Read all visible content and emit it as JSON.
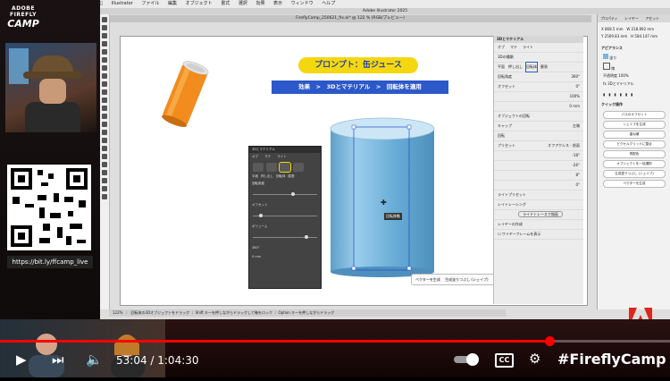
{
  "stream": {
    "logo_line1": "ADOBE FIREFLY",
    "logo_line2": "CAMP",
    "qr_link": "https://bit.ly/ffcamp_live",
    "hashtag": "#FireflyCamp"
  },
  "illustrator": {
    "menu": [
      "Illustrator",
      "ファイル",
      "編集",
      "オブジェクト",
      "書式",
      "選択",
      "効果",
      "表示",
      "ウィンドウ",
      "ヘルプ"
    ],
    "window_title": "Adobe Illustrator 2025",
    "doc_tab": "FireflyCamp_250621_fix.ai* @ 122 % (RGB/プレビュー)",
    "status_text": "回転体の3Dオブジェクトをドラッグ ｜ Shift キーを押しながらドラッグして軸をロック ｜ Option キーを押しながらドラッグ",
    "zoom": "122%"
  },
  "artboard": {
    "prompt_label": "プロンプト：缶ジュース",
    "path_label": "効果　>　3Dとマテリアル　>　回転体を適用",
    "cursor_tooltip": "回転移動"
  },
  "inner_panel": {
    "title": "3Dとマテリアル",
    "tabs": [
      "オブ",
      "マテ",
      "ライト"
    ],
    "type_buttons": [
      "平面",
      "押し出し",
      "回転体",
      "膨張"
    ],
    "rows": [
      "回転角度",
      "オフセット",
      "ボリューム",
      "360°",
      "0 mm"
    ]
  },
  "context_bar": {
    "generate_vector": "ベクターを生成",
    "generate_pattern": "生成塗りつぶし (シェイプ)"
  },
  "panel3d": {
    "title": "3Dとマテリアル",
    "tabs": [
      "オブ",
      "マテ",
      "ライト"
    ],
    "sections": [
      "3Dの種類",
      "回転角度",
      "オフセット",
      "オブジェクトの回転",
      "キャップ",
      "回転",
      "プリセット",
      "ライトプリセット",
      "レイヤーの作成"
    ],
    "values": [
      "360°",
      "0°",
      "100%",
      "0 mm",
      "-18°",
      "-26°",
      "8°",
      "0°"
    ],
    "buttons": [
      "ライドトレースで描画"
    ],
    "type_labels": [
      "平面",
      "押し出し",
      "回転体",
      "膨張"
    ],
    "preset": "オフアクシス - 前面",
    "cap": "左端",
    "raytrace_label": "レイトレーシング",
    "checkbox_label": "ワイヤーフレームを表示"
  },
  "properties": {
    "tabs": [
      "プロパティ",
      "レイヤー",
      "アセット"
    ],
    "transform": {
      "x": "868.5 mm",
      "y": "2509.83 mm",
      "w": "218.892 mm",
      "h": "584.147 mm"
    },
    "appearance_label": "アピアランス",
    "fill": "塗り",
    "stroke": "線",
    "opacity": "不透明度",
    "opacity_value": "100%",
    "effect": "3Dとマテリアル",
    "quick_actions_label": "クイック操作",
    "actions": [
      "パスのオフセット",
      "シェイプを生成",
      "重ね順",
      "ピクセルグリッドに整合",
      "再配色",
      "オブジェクトを一括選択",
      "生成塗りつぶし (シェイプ)",
      "ベクターを生成"
    ]
  },
  "player": {
    "time": "53:04 / 1:04:30",
    "progress": 0.82,
    "cc_label": "CC"
  },
  "colors": {
    "accent_yellow": "#f5d70f",
    "accent_blue": "#2c58c9",
    "can_orange": "#f28c1e",
    "cylinder_blue": "#7ab7df",
    "progress_red": "#ff0000"
  }
}
